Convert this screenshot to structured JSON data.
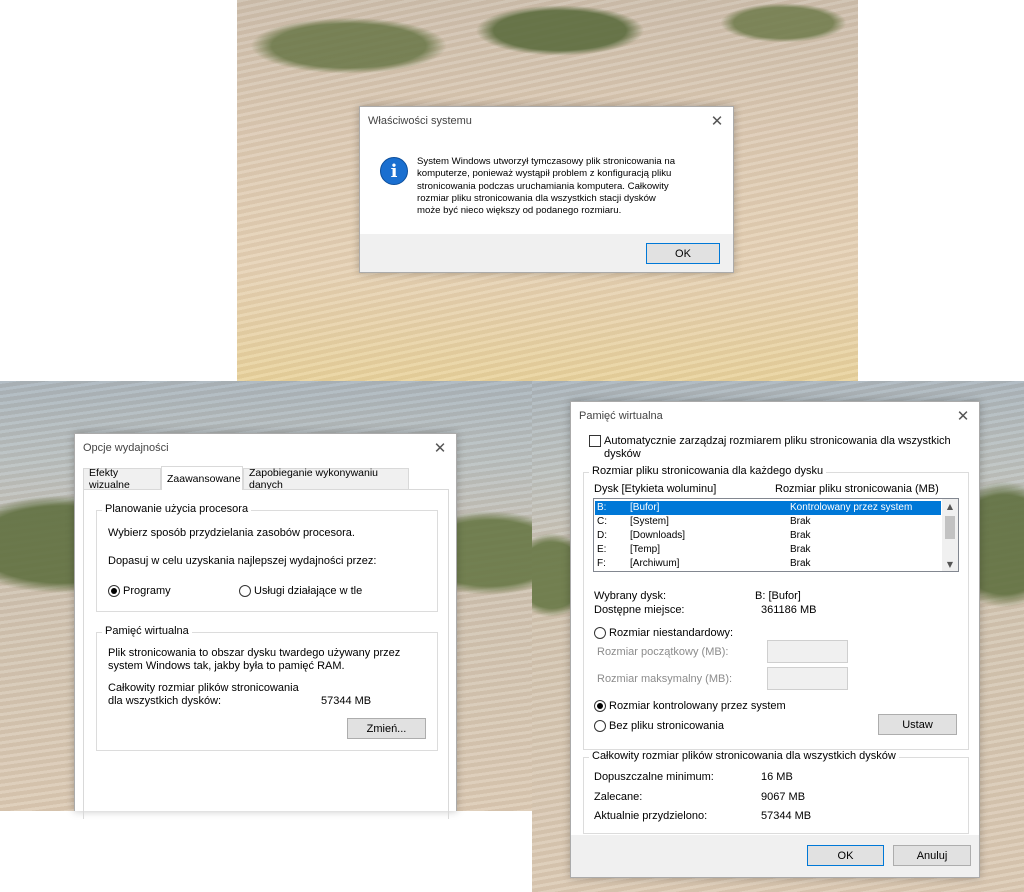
{
  "system_dialog": {
    "title": "Właściwości systemu",
    "message_lines": [
      "System Windows utworzył tymczasowy plik stronicowania na",
      "komputerze, ponieważ wystąpił problem z konfiguracją pliku",
      "stronicowania podczas uruchamiania komputera. Całkowity",
      "rozmiar pliku stronicowania dla wszystkich stacji dysków",
      "może być nieco większy od podanego rozmiaru."
    ],
    "ok_label": "OK"
  },
  "performance_dialog": {
    "title": "Opcje wydajności",
    "tabs": [
      {
        "label": "Efekty wizualne",
        "active": false
      },
      {
        "label": "Zaawansowane",
        "active": true
      },
      {
        "label": "Zapobieganie wykonywaniu danych",
        "active": false
      }
    ],
    "cpu_group": {
      "title": "Planowanie użycia procesora",
      "description": "Wybierz sposób przydzielania zasobów procesora.",
      "adjust_label": "Dopasuj w celu uzyskania najlepszej wydajności przez:",
      "option_programs": "Programy",
      "option_services": "Usługi działające w tle",
      "selected": "Programy"
    },
    "vm_group": {
      "title": "Pamięć wirtualna",
      "description_lines": [
        "Plik stronicowania to obszar dysku twardego używany przez",
        "system Windows tak, jakby była to pamięć RAM."
      ],
      "total_label_lines": [
        "Całkowity rozmiar plików stronicowania",
        "dla wszystkich dysków:"
      ],
      "total_value": "57344  MB",
      "change_button": "Zmień..."
    }
  },
  "virtual_memory_dialog": {
    "title": "Pamięć wirtualna",
    "auto_manage_lines": [
      "Automatycznie zarządzaj rozmiarem pliku stronicowania dla wszystkich",
      "dysków"
    ],
    "auto_manage_checked": false,
    "per_drive_group": {
      "title": "Rozmiar pliku stronicowania dla każdego dysku",
      "col_drive": "Dysk [Etykieta woluminu]",
      "col_size": "Rozmiar pliku stronicowania (MB)",
      "drives": [
        {
          "letter": "B:",
          "label": "[Bufor]",
          "size": "Kontrolowany przez system",
          "selected": true
        },
        {
          "letter": "C:",
          "label": "[System]",
          "size": "Brak",
          "selected": false
        },
        {
          "letter": "D:",
          "label": "[Downloads]",
          "size": "Brak",
          "selected": false
        },
        {
          "letter": "E:",
          "label": "[Temp]",
          "size": "Brak",
          "selected": false
        },
        {
          "letter": "F:",
          "label": "[Archiwum]",
          "size": "Brak",
          "selected": false
        }
      ],
      "selected_drive_label": "Wybrany dysk:",
      "selected_drive_value": "B:  [Bufor]",
      "free_space_label": "Dostępne miejsce:",
      "free_space_value": "361186  MB",
      "custom_size_label": "Rozmiar niestandardowy:",
      "initial_size_label": "Rozmiar początkowy (MB):",
      "max_size_label": "Rozmiar maksymalny (MB):",
      "system_managed_label": "Rozmiar kontrolowany przez system",
      "no_paging_label": "Bez pliku stronicowania",
      "set_button": "Ustaw",
      "selected_option": "system_managed"
    },
    "total_group": {
      "title": "Całkowity rozmiar plików stronicowania dla wszystkich dysków",
      "min_label": "Dopuszczalne minimum:",
      "min_value": "16  MB",
      "recommended_label": "Zalecane:",
      "recommended_value": "9067  MB",
      "allocated_label": "Aktualnie przydzielono:",
      "allocated_value": "57344  MB"
    },
    "ok_label": "OK",
    "cancel_label": "Anuluj"
  }
}
